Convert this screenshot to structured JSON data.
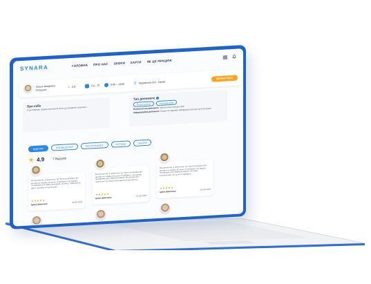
{
  "nav": {
    "logo": "SYNARA",
    "items": [
      "ГОЛОВНА",
      "ПРО НАС",
      "ЗБОРИ",
      "КАРТИ",
      "ЯК ЦЕ ПРАЦЮЄ"
    ]
  },
  "profile": {
    "name": "Ольга Іващенко Угорська",
    "rating": "4.9",
    "days": "Пн – Пт",
    "hours": "9:00 – 18:00",
    "location": "Харківська обл., Харків",
    "contact_button": "ЗВ'ЯЗАТИСЯ"
  },
  "about": {
    "title": "Про себе",
    "text": "Я допомагаю людям прокласти шлях до розумного рішення..."
  },
  "help_types": {
    "title": "Тип допомоги",
    "tags": [
      "Психологічна",
      "Інформаційна"
    ],
    "line1_label": "Психологічна допомога:",
    "line1_text": "психологічні консультації",
    "line2_label": "Інформаційна допомога:",
    "line2_text": "Пошук та надання інформації про доступні ресурси"
  },
  "tabs": [
    "ВІДГУКИ",
    "ОПОВІЩЕННЯ",
    "ПОСЛУЖНИЦТ",
    "ПЕТИЦІЇ",
    "ЗБОРИ"
  ],
  "summary": {
    "score": "4.9",
    "count": "7 Відгуків"
  },
  "reviews": [
    {
      "text": "Ви допомогли, я опинилась тут багато можливостей допомогти людям, які цього потребують. Це чудова платформа для обміну досвідом, на жаль, з'являються друзі. За кожну консультацію...",
      "stars": "★★★★★",
      "author": "Ірина Шевченко",
      "date": "20.06.2023"
    },
    {
      "text": "Ви допомогли, я опинилась тут багато можливостей допомогти людям, які цього потребують. Це чудова платформа для обміну досвідом. Ви допомогли, і опинилася тут багато можливостей допомогти...",
      "stars": "★★★★★",
      "author": "Ірина Шевченко",
      "date": "20.06.2023"
    },
    {
      "text": "Ви допомогли, я опинилась тут багато можливостей допомогти людям, які цього потребують. Це чудова платформа для обміну досвідом. За кожну консультацію, які цього потребують...",
      "stars": "★★★★★",
      "author": "Ірина Шевченко",
      "date": "20.06.2023"
    }
  ],
  "colors": {
    "brand": "#2a86e8",
    "frame": "#1f63c9",
    "accent": "#ffa21a",
    "star": "#ffb21a"
  }
}
